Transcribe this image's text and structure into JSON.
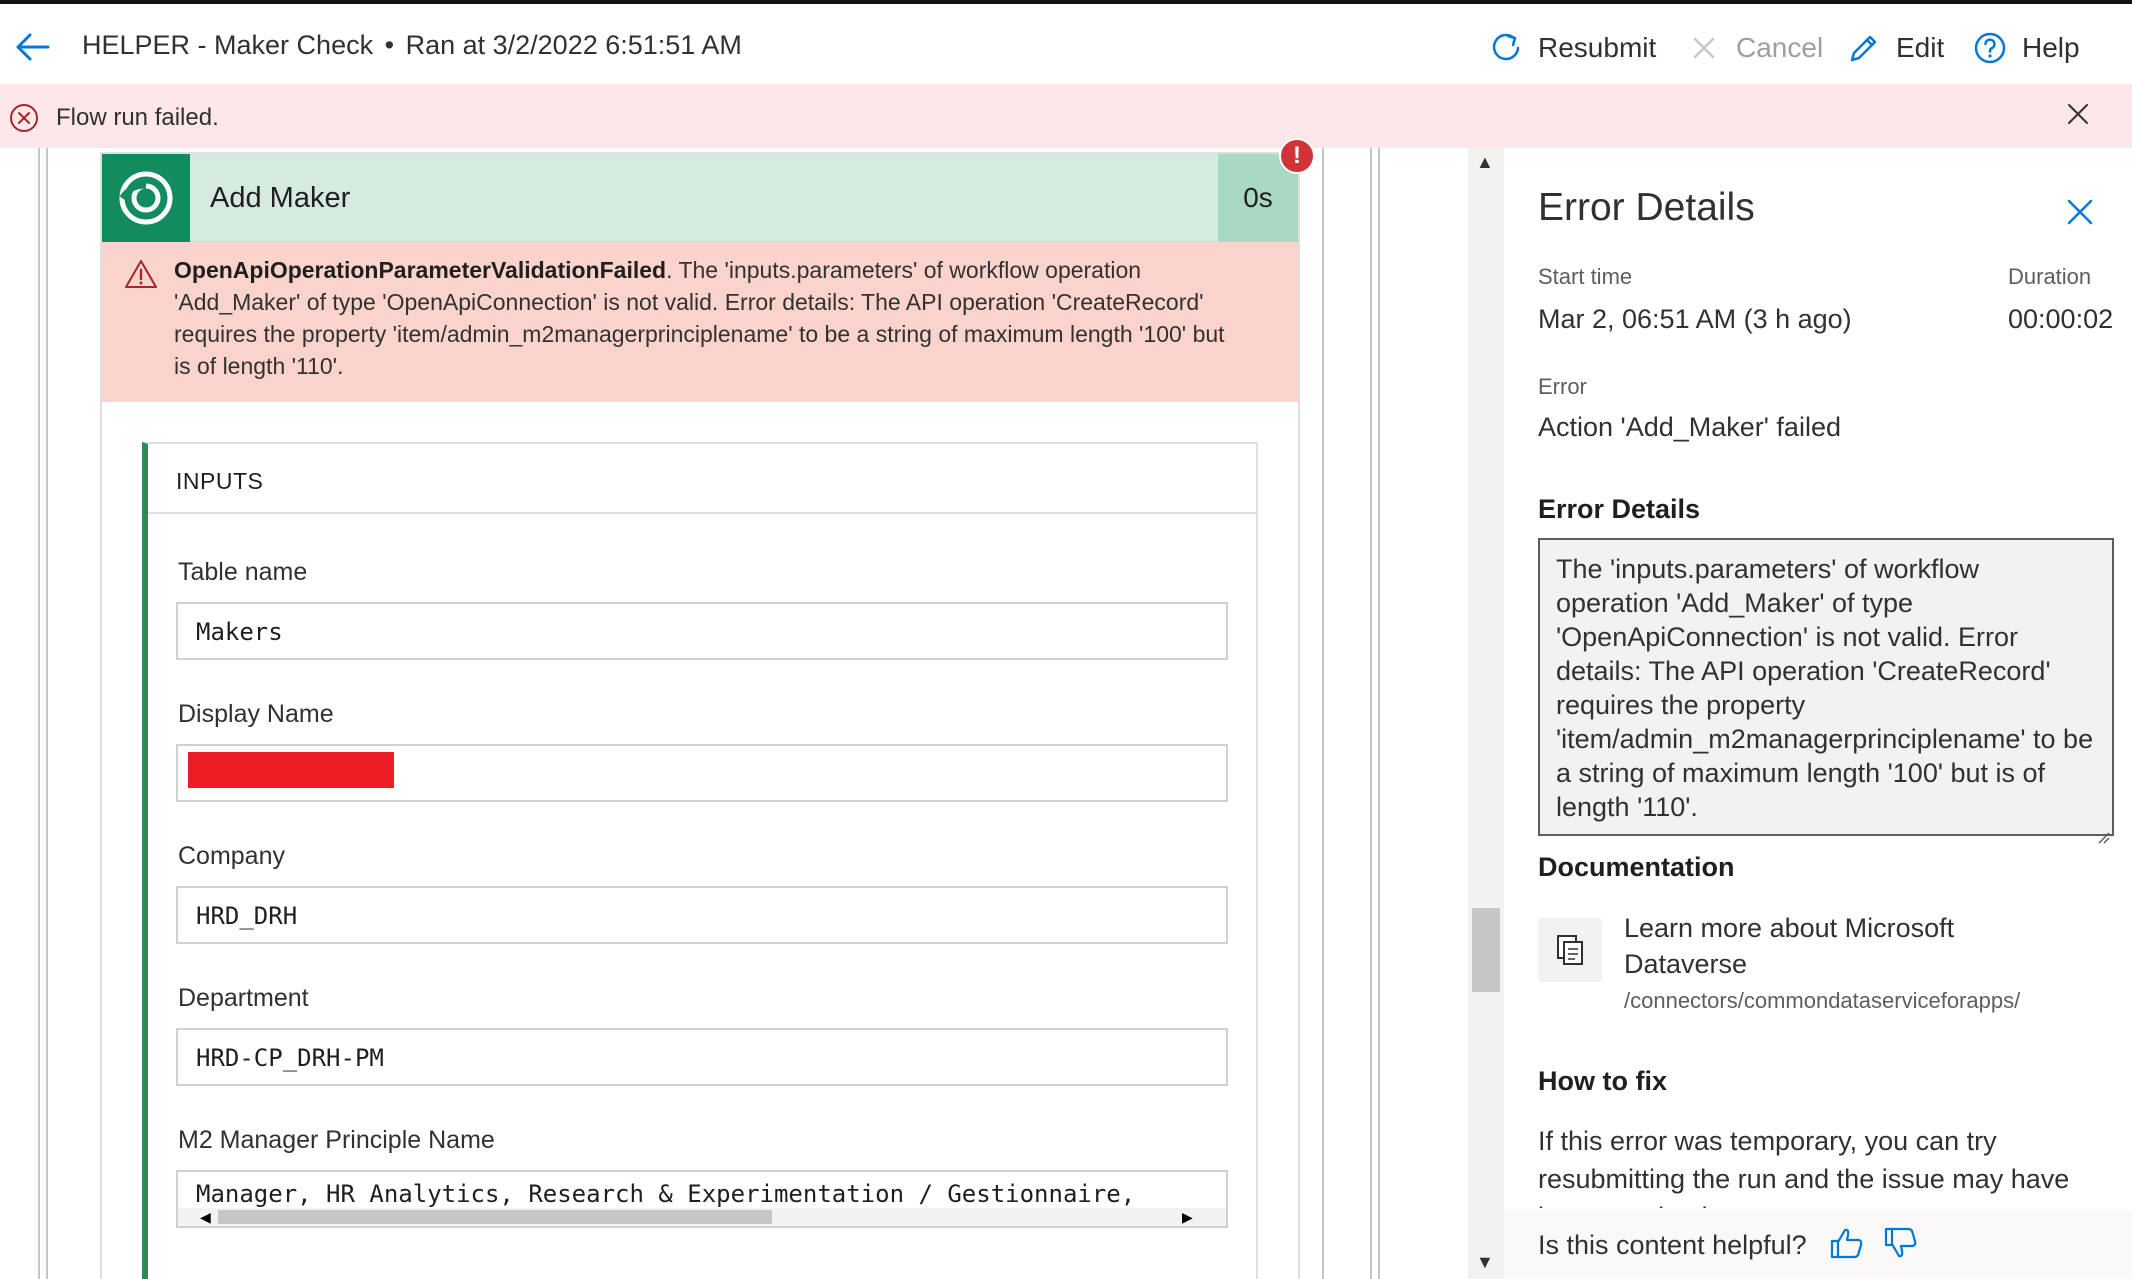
{
  "header": {
    "flow_name": "HELPER - Maker Check",
    "separator": "•",
    "run_info": "Ran at 3/2/2022 6:51:51 AM",
    "resubmit_label": "Resubmit",
    "cancel_label": "Cancel",
    "edit_label": "Edit",
    "help_label": "Help",
    "accent_color": "#0078d4"
  },
  "banner": {
    "message": "Flow run failed.",
    "color": "#fde7e9"
  },
  "action_card": {
    "title": "Add Maker",
    "duration": "0s",
    "error_badge": "!",
    "error_code": "OpenApiOperationParameterValidationFailed",
    "error_message": ". The 'inputs.parameters' of workflow operation 'Add_Maker' of type 'OpenApiConnection' is not valid. Error details: The API operation 'CreateRecord' requires the property 'item/admin_m2managerprinciplename' to be a string of maximum length '100' but is of length '110'.",
    "inputs_title": "INPUTS",
    "fields": [
      {
        "label": "Table name",
        "value": "Makers"
      },
      {
        "label": "Display Name",
        "value": ""
      },
      {
        "label": "Company",
        "value": "HRD_DRH"
      },
      {
        "label": "Department",
        "value": "HRD-CP_DRH-PM"
      },
      {
        "label": "M2 Manager Principle Name",
        "value": "Manager, HR Analytics, Research & Experimentation  / Gestionnaire,"
      }
    ]
  },
  "details": {
    "title": "Error Details",
    "start_time_label": "Start time",
    "start_time": "Mar 2, 06:51 AM (3 h ago)",
    "duration_label": "Duration",
    "duration": "00:00:02",
    "error_label": "Error",
    "error": "Action 'Add_Maker' failed",
    "error_details_heading": "Error Details",
    "error_details_text": "The 'inputs.parameters' of workflow operation 'Add_Maker' of type 'OpenApiConnection' is not valid. Error details: The API operation 'CreateRecord' requires the property 'item/admin_m2managerprinciplename' to be a string of maximum length '100' but is of length '110'.",
    "documentation_heading": "Documentation",
    "doc_link_text": "Learn more about Microsoft Dataverse",
    "doc_url": "/connectors/commondataserviceforapps/",
    "how_to_fix_heading": "How to fix",
    "how_to_fix_text": "If this error was temporary, you can try resubmitting the run and the issue may have been resolved.",
    "feedback_question": "Is this content helpful?"
  }
}
